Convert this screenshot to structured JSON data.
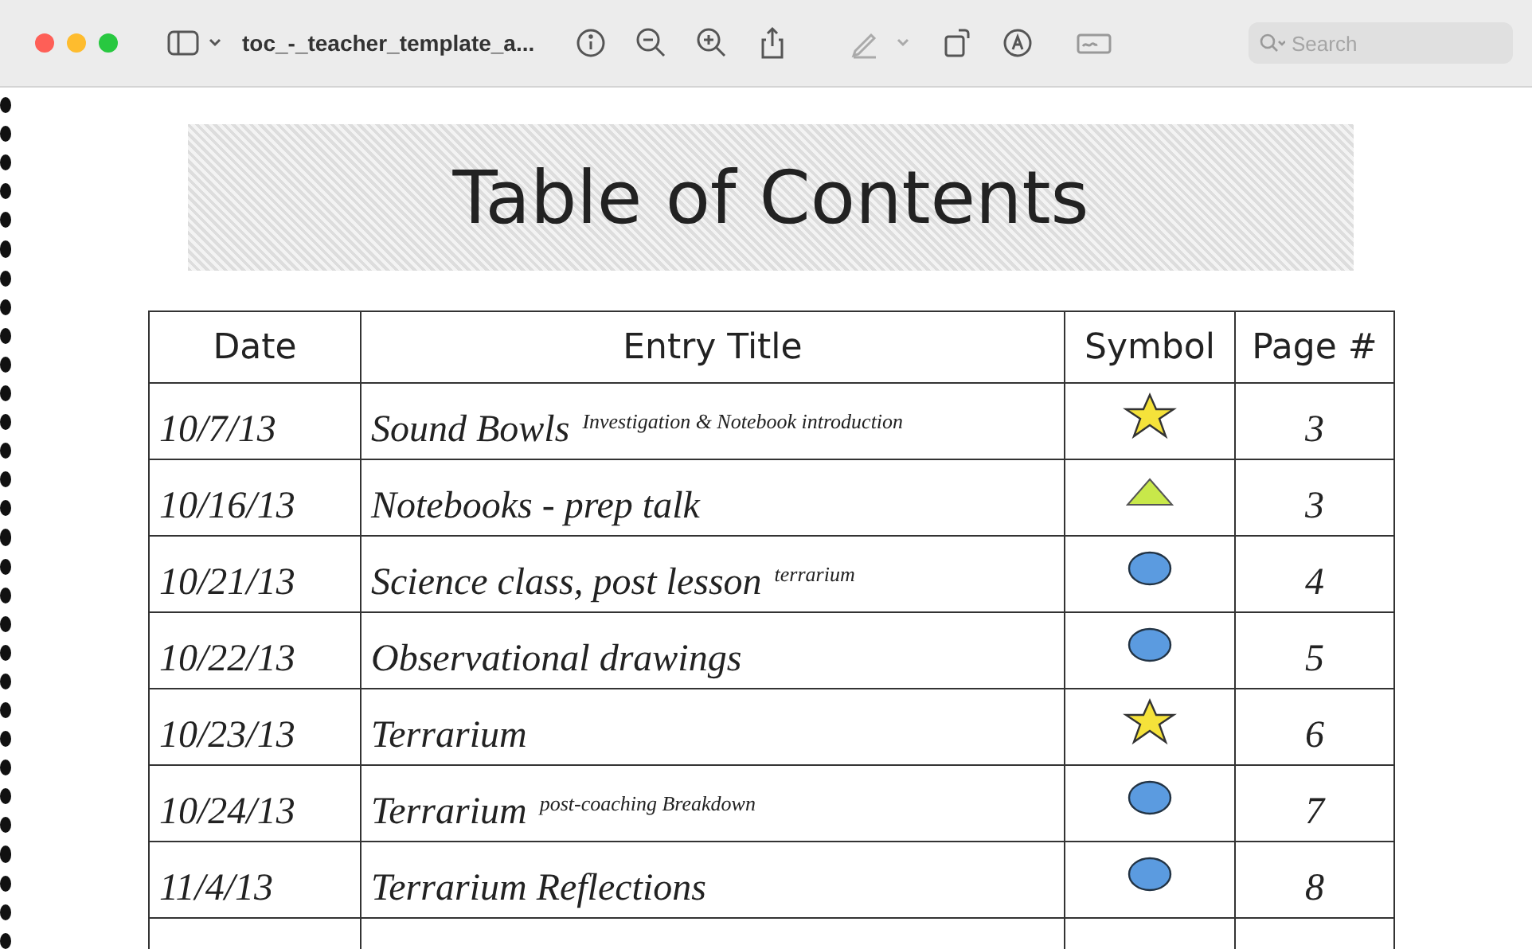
{
  "window": {
    "title": "toc_-_teacher_template_a...",
    "search": {
      "placeholder": "Search"
    }
  },
  "document": {
    "heading": "Table of Contents",
    "columns": [
      "Date",
      "Entry Title",
      "Symbol",
      "Page #"
    ],
    "rows": [
      {
        "date": "10/7/13",
        "title": "Sound Bowls",
        "note": "Investigation & Notebook introduction",
        "kind": "star",
        "page": "3"
      },
      {
        "date": "10/16/13",
        "title": "Notebooks - prep talk",
        "kind": "triangle",
        "page": "3"
      },
      {
        "date": "10/21/13",
        "title": "Science class, post lesson",
        "note": "terrarium",
        "kind": "oval",
        "page": "4"
      },
      {
        "date": "10/22/13",
        "title": "Observational drawings",
        "kind": "oval",
        "page": "5"
      },
      {
        "date": "10/23/13",
        "title": "Terrarium",
        "kind": "star",
        "page": "6"
      },
      {
        "date": "10/24/13",
        "title": "Terrarium",
        "note": "post-coaching Breakdown",
        "kind": "oval",
        "page": "7"
      },
      {
        "date": "11/4/13",
        "title": "Terrarium Reflections",
        "kind": "oval",
        "page": "8"
      }
    ]
  }
}
